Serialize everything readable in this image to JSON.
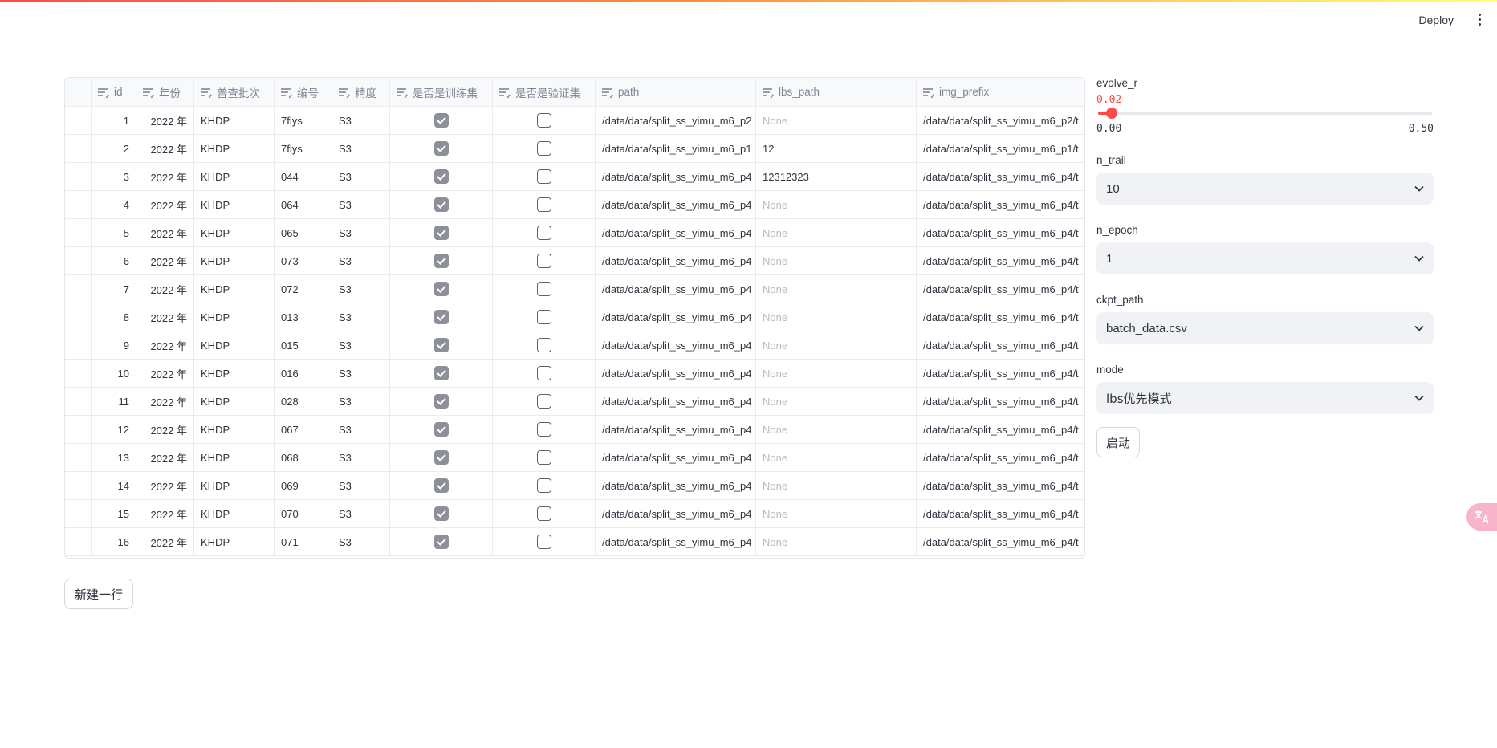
{
  "header": {
    "deploy_label": "Deploy"
  },
  "table": {
    "columns": [
      "id",
      "年份",
      "普查批次",
      "编号",
      "精度",
      "是否是训练集",
      "是否是验证集",
      "path",
      "lbs_path",
      "img_prefix"
    ],
    "rows": [
      {
        "id": "1",
        "year": "2022 年",
        "batch": "KHDP",
        "code": "7flys",
        "precision": "S3",
        "train": true,
        "val": false,
        "path": "/data/data/split_ss_yimu_m6_p2",
        "lbs_path": "None",
        "lbs_none": true,
        "img_prefix": "/data/data/split_ss_yimu_m6_p2/t"
      },
      {
        "id": "2",
        "year": "2022 年",
        "batch": "KHDP",
        "code": "7flys",
        "precision": "S3",
        "train": true,
        "val": false,
        "path": "/data/data/split_ss_yimu_m6_p1",
        "lbs_path": "12",
        "lbs_none": false,
        "img_prefix": "/data/data/split_ss_yimu_m6_p1/t"
      },
      {
        "id": "3",
        "year": "2022 年",
        "batch": "KHDP",
        "code": "044",
        "precision": "S3",
        "train": true,
        "val": false,
        "path": "/data/data/split_ss_yimu_m6_p4",
        "lbs_path": "12312323",
        "lbs_none": false,
        "img_prefix": "/data/data/split_ss_yimu_m6_p4/t"
      },
      {
        "id": "4",
        "year": "2022 年",
        "batch": "KHDP",
        "code": "064",
        "precision": "S3",
        "train": true,
        "val": false,
        "path": "/data/data/split_ss_yimu_m6_p4",
        "lbs_path": "None",
        "lbs_none": true,
        "img_prefix": "/data/data/split_ss_yimu_m6_p4/t"
      },
      {
        "id": "5",
        "year": "2022 年",
        "batch": "KHDP",
        "code": "065",
        "precision": "S3",
        "train": true,
        "val": false,
        "path": "/data/data/split_ss_yimu_m6_p4",
        "lbs_path": "None",
        "lbs_none": true,
        "img_prefix": "/data/data/split_ss_yimu_m6_p4/t"
      },
      {
        "id": "6",
        "year": "2022 年",
        "batch": "KHDP",
        "code": "073",
        "precision": "S3",
        "train": true,
        "val": false,
        "path": "/data/data/split_ss_yimu_m6_p4",
        "lbs_path": "None",
        "lbs_none": true,
        "img_prefix": "/data/data/split_ss_yimu_m6_p4/t"
      },
      {
        "id": "7",
        "year": "2022 年",
        "batch": "KHDP",
        "code": "072",
        "precision": "S3",
        "train": true,
        "val": false,
        "path": "/data/data/split_ss_yimu_m6_p4",
        "lbs_path": "None",
        "lbs_none": true,
        "img_prefix": "/data/data/split_ss_yimu_m6_p4/t"
      },
      {
        "id": "8",
        "year": "2022 年",
        "batch": "KHDP",
        "code": "013",
        "precision": "S3",
        "train": true,
        "val": false,
        "path": "/data/data/split_ss_yimu_m6_p4",
        "lbs_path": "None",
        "lbs_none": true,
        "img_prefix": "/data/data/split_ss_yimu_m6_p4/t"
      },
      {
        "id": "9",
        "year": "2022 年",
        "batch": "KHDP",
        "code": "015",
        "precision": "S3",
        "train": true,
        "val": false,
        "path": "/data/data/split_ss_yimu_m6_p4",
        "lbs_path": "None",
        "lbs_none": true,
        "img_prefix": "/data/data/split_ss_yimu_m6_p4/t"
      },
      {
        "id": "10",
        "year": "2022 年",
        "batch": "KHDP",
        "code": "016",
        "precision": "S3",
        "train": true,
        "val": false,
        "path": "/data/data/split_ss_yimu_m6_p4",
        "lbs_path": "None",
        "lbs_none": true,
        "img_prefix": "/data/data/split_ss_yimu_m6_p4/t"
      },
      {
        "id": "11",
        "year": "2022 年",
        "batch": "KHDP",
        "code": "028",
        "precision": "S3",
        "train": true,
        "val": false,
        "path": "/data/data/split_ss_yimu_m6_p4",
        "lbs_path": "None",
        "lbs_none": true,
        "img_prefix": "/data/data/split_ss_yimu_m6_p4/t"
      },
      {
        "id": "12",
        "year": "2022 年",
        "batch": "KHDP",
        "code": "067",
        "precision": "S3",
        "train": true,
        "val": false,
        "path": "/data/data/split_ss_yimu_m6_p4",
        "lbs_path": "None",
        "lbs_none": true,
        "img_prefix": "/data/data/split_ss_yimu_m6_p4/t"
      },
      {
        "id": "13",
        "year": "2022 年",
        "batch": "KHDP",
        "code": "068",
        "precision": "S3",
        "train": true,
        "val": false,
        "path": "/data/data/split_ss_yimu_m6_p4",
        "lbs_path": "None",
        "lbs_none": true,
        "img_prefix": "/data/data/split_ss_yimu_m6_p4/t"
      },
      {
        "id": "14",
        "year": "2022 年",
        "batch": "KHDP",
        "code": "069",
        "precision": "S3",
        "train": true,
        "val": false,
        "path": "/data/data/split_ss_yimu_m6_p4",
        "lbs_path": "None",
        "lbs_none": true,
        "img_prefix": "/data/data/split_ss_yimu_m6_p4/t"
      },
      {
        "id": "15",
        "year": "2022 年",
        "batch": "KHDP",
        "code": "070",
        "precision": "S3",
        "train": true,
        "val": false,
        "path": "/data/data/split_ss_yimu_m6_p4",
        "lbs_path": "None",
        "lbs_none": true,
        "img_prefix": "/data/data/split_ss_yimu_m6_p4/t"
      },
      {
        "id": "16",
        "year": "2022 年",
        "batch": "KHDP",
        "code": "071",
        "precision": "S3",
        "train": true,
        "val": false,
        "path": "/data/data/split_ss_yimu_m6_p4",
        "lbs_path": "None",
        "lbs_none": true,
        "img_prefix": "/data/data/split_ss_yimu_m6_p4/t"
      }
    ],
    "add_row_label": "新建一行"
  },
  "panel": {
    "evolve_r": {
      "label": "evolve_r",
      "value": "0.02",
      "min": "0.00",
      "max": "0.50",
      "fraction": 0.04,
      "accent": "#ff4b4b"
    },
    "n_trail": {
      "label": "n_trail",
      "value": "10"
    },
    "n_epoch": {
      "label": "n_epoch",
      "value": "1"
    },
    "ckpt_path": {
      "label": "ckpt_path",
      "value": "batch_data.csv"
    },
    "mode": {
      "label": "mode",
      "value": "lbs优先模式"
    },
    "launch_label": "启动"
  }
}
